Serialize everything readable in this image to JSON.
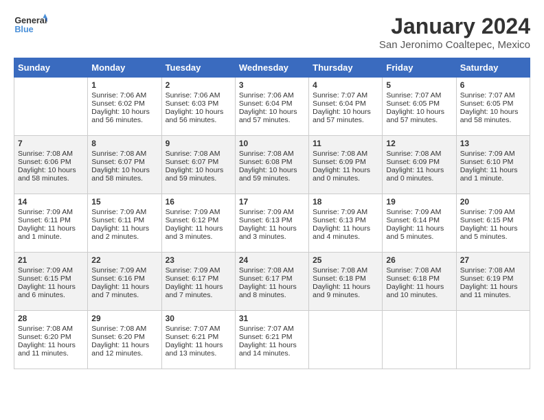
{
  "header": {
    "logo_line1": "General",
    "logo_line2": "Blue",
    "title": "January 2024",
    "subtitle": "San Jeronimo Coaltepec, Mexico"
  },
  "days_of_week": [
    "Sunday",
    "Monday",
    "Tuesday",
    "Wednesday",
    "Thursday",
    "Friday",
    "Saturday"
  ],
  "weeks": [
    [
      {
        "num": "",
        "info": ""
      },
      {
        "num": "1",
        "info": "Sunrise: 7:06 AM\nSunset: 6:02 PM\nDaylight: 10 hours\nand 56 minutes."
      },
      {
        "num": "2",
        "info": "Sunrise: 7:06 AM\nSunset: 6:03 PM\nDaylight: 10 hours\nand 56 minutes."
      },
      {
        "num": "3",
        "info": "Sunrise: 7:06 AM\nSunset: 6:04 PM\nDaylight: 10 hours\nand 57 minutes."
      },
      {
        "num": "4",
        "info": "Sunrise: 7:07 AM\nSunset: 6:04 PM\nDaylight: 10 hours\nand 57 minutes."
      },
      {
        "num": "5",
        "info": "Sunrise: 7:07 AM\nSunset: 6:05 PM\nDaylight: 10 hours\nand 57 minutes."
      },
      {
        "num": "6",
        "info": "Sunrise: 7:07 AM\nSunset: 6:05 PM\nDaylight: 10 hours\nand 58 minutes."
      }
    ],
    [
      {
        "num": "7",
        "info": "Sunrise: 7:08 AM\nSunset: 6:06 PM\nDaylight: 10 hours\nand 58 minutes."
      },
      {
        "num": "8",
        "info": "Sunrise: 7:08 AM\nSunset: 6:07 PM\nDaylight: 10 hours\nand 58 minutes."
      },
      {
        "num": "9",
        "info": "Sunrise: 7:08 AM\nSunset: 6:07 PM\nDaylight: 10 hours\nand 59 minutes."
      },
      {
        "num": "10",
        "info": "Sunrise: 7:08 AM\nSunset: 6:08 PM\nDaylight: 10 hours\nand 59 minutes."
      },
      {
        "num": "11",
        "info": "Sunrise: 7:08 AM\nSunset: 6:09 PM\nDaylight: 11 hours\nand 0 minutes."
      },
      {
        "num": "12",
        "info": "Sunrise: 7:08 AM\nSunset: 6:09 PM\nDaylight: 11 hours\nand 0 minutes."
      },
      {
        "num": "13",
        "info": "Sunrise: 7:09 AM\nSunset: 6:10 PM\nDaylight: 11 hours\nand 1 minute."
      }
    ],
    [
      {
        "num": "14",
        "info": "Sunrise: 7:09 AM\nSunset: 6:11 PM\nDaylight: 11 hours\nand 1 minute."
      },
      {
        "num": "15",
        "info": "Sunrise: 7:09 AM\nSunset: 6:11 PM\nDaylight: 11 hours\nand 2 minutes."
      },
      {
        "num": "16",
        "info": "Sunrise: 7:09 AM\nSunset: 6:12 PM\nDaylight: 11 hours\nand 3 minutes."
      },
      {
        "num": "17",
        "info": "Sunrise: 7:09 AM\nSunset: 6:13 PM\nDaylight: 11 hours\nand 3 minutes."
      },
      {
        "num": "18",
        "info": "Sunrise: 7:09 AM\nSunset: 6:13 PM\nDaylight: 11 hours\nand 4 minutes."
      },
      {
        "num": "19",
        "info": "Sunrise: 7:09 AM\nSunset: 6:14 PM\nDaylight: 11 hours\nand 5 minutes."
      },
      {
        "num": "20",
        "info": "Sunrise: 7:09 AM\nSunset: 6:15 PM\nDaylight: 11 hours\nand 5 minutes."
      }
    ],
    [
      {
        "num": "21",
        "info": "Sunrise: 7:09 AM\nSunset: 6:15 PM\nDaylight: 11 hours\nand 6 minutes."
      },
      {
        "num": "22",
        "info": "Sunrise: 7:09 AM\nSunset: 6:16 PM\nDaylight: 11 hours\nand 7 minutes."
      },
      {
        "num": "23",
        "info": "Sunrise: 7:09 AM\nSunset: 6:17 PM\nDaylight: 11 hours\nand 7 minutes."
      },
      {
        "num": "24",
        "info": "Sunrise: 7:08 AM\nSunset: 6:17 PM\nDaylight: 11 hours\nand 8 minutes."
      },
      {
        "num": "25",
        "info": "Sunrise: 7:08 AM\nSunset: 6:18 PM\nDaylight: 11 hours\nand 9 minutes."
      },
      {
        "num": "26",
        "info": "Sunrise: 7:08 AM\nSunset: 6:18 PM\nDaylight: 11 hours\nand 10 minutes."
      },
      {
        "num": "27",
        "info": "Sunrise: 7:08 AM\nSunset: 6:19 PM\nDaylight: 11 hours\nand 11 minutes."
      }
    ],
    [
      {
        "num": "28",
        "info": "Sunrise: 7:08 AM\nSunset: 6:20 PM\nDaylight: 11 hours\nand 11 minutes."
      },
      {
        "num": "29",
        "info": "Sunrise: 7:08 AM\nSunset: 6:20 PM\nDaylight: 11 hours\nand 12 minutes."
      },
      {
        "num": "30",
        "info": "Sunrise: 7:07 AM\nSunset: 6:21 PM\nDaylight: 11 hours\nand 13 minutes."
      },
      {
        "num": "31",
        "info": "Sunrise: 7:07 AM\nSunset: 6:21 PM\nDaylight: 11 hours\nand 14 minutes."
      },
      {
        "num": "",
        "info": ""
      },
      {
        "num": "",
        "info": ""
      },
      {
        "num": "",
        "info": ""
      }
    ]
  ]
}
